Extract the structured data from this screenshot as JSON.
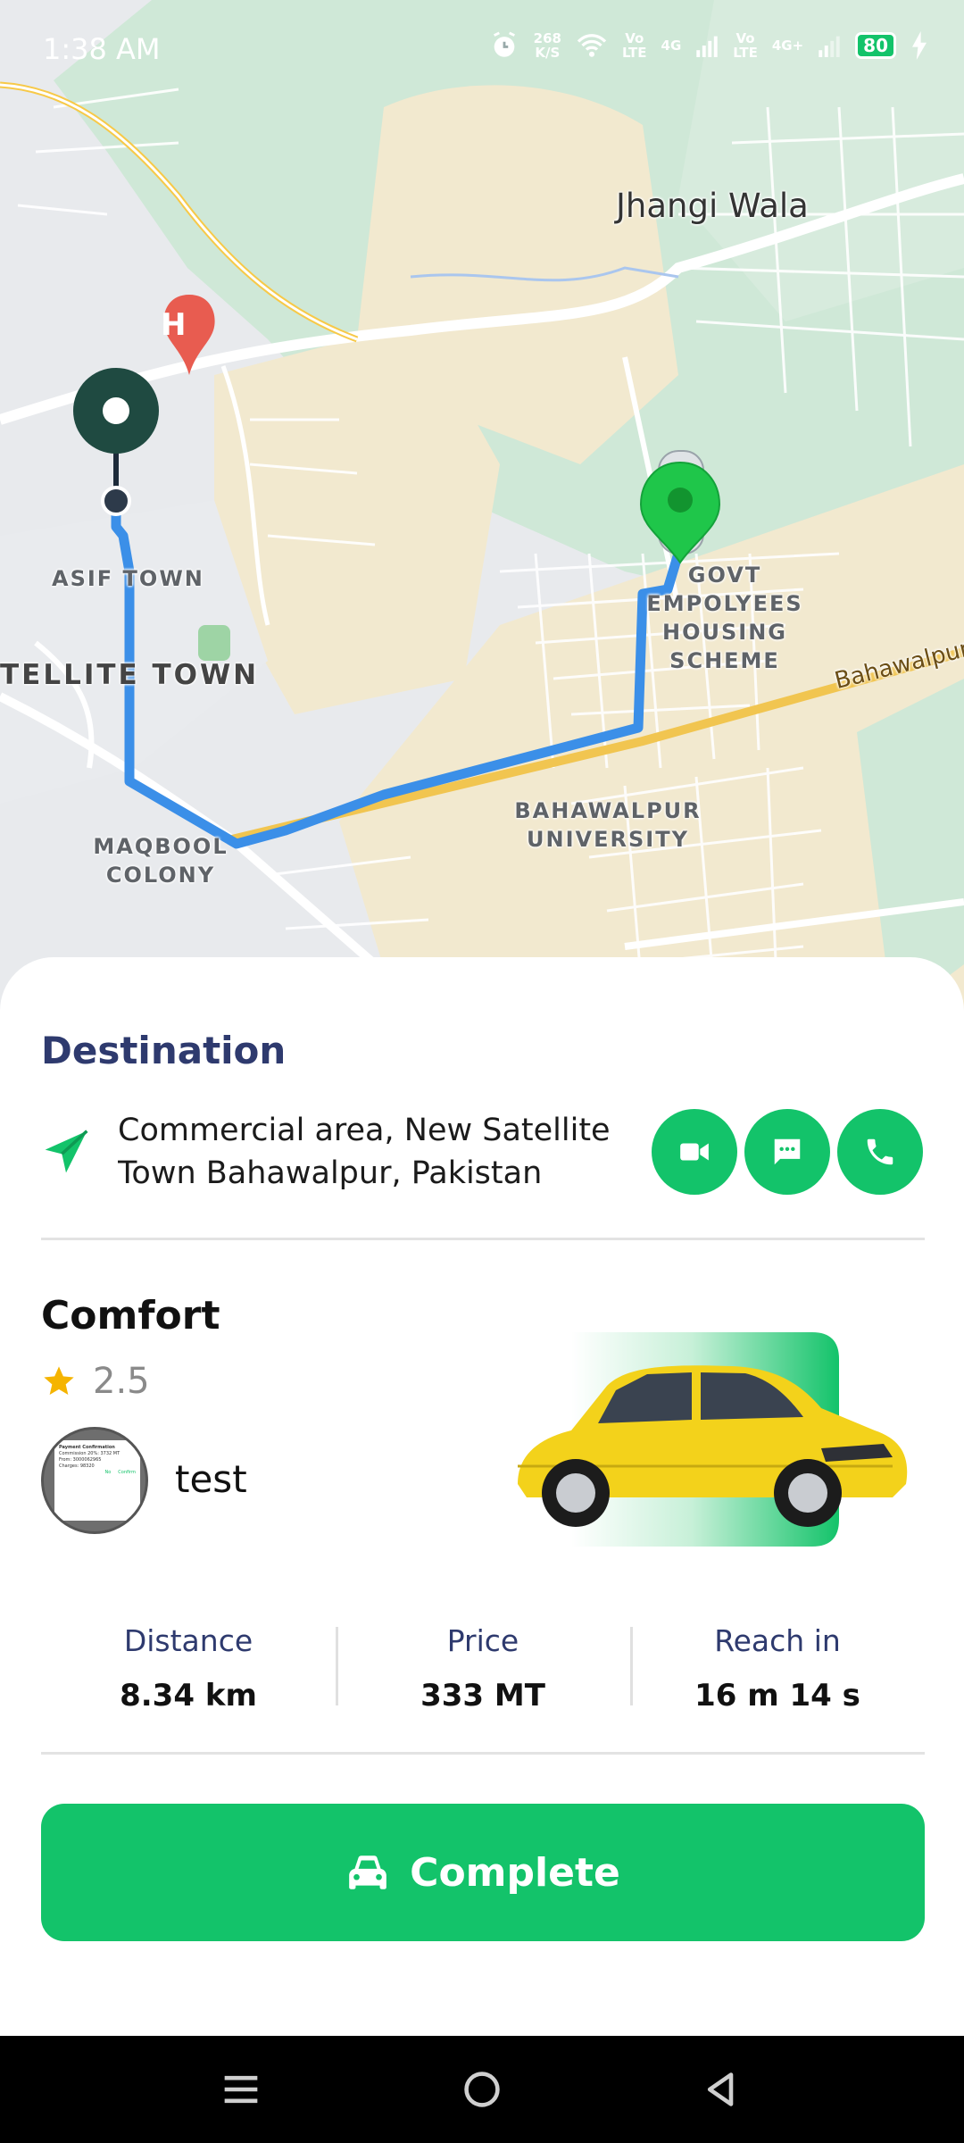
{
  "status_bar": {
    "time": "1:38 AM",
    "net_speed_value": "268",
    "net_speed_unit": "K/S",
    "sim1_top": "Vo",
    "sim1_bottom": "LTE",
    "sim1_gen": "4G",
    "sim2_top": "Vo",
    "sim2_bottom": "LTE",
    "sim2_gen": "4G+",
    "battery": "80"
  },
  "map": {
    "labels": {
      "jhangi_wala": "Jhangi Wala",
      "asif_town": "ASIF TOWN",
      "satellite_town": "TELLITE TOWN",
      "govt_housing": [
        "GOVT",
        "EMPOLYEES",
        "HOUSING",
        "SCHEME"
      ],
      "bahawalpur_road": "Bahawalpur",
      "bahawalpur_university": [
        "BAHAWALPUR",
        "UNIVERSITY"
      ],
      "maqbool_colony": [
        "MAQBOOL",
        "COLONY"
      ]
    },
    "hospital_marker": "H",
    "route_color": "#3b8fe8",
    "destination_pin_color": "#1f4a41",
    "car_pin_color": "#1fc64a"
  },
  "destination": {
    "title": "Destination",
    "address": "Commercial area, New Satellite Town Bahawalpur, Pakistan"
  },
  "actions": {
    "video_icon": "video-camera-icon",
    "chat_icon": "chat-bubble-icon",
    "call_icon": "phone-icon"
  },
  "ride": {
    "vehicle_type": "Comfort",
    "rating": "2.5",
    "driver_name": "test",
    "avatar_text": [
      "Payment Confirmation",
      "Commission 20%: 3732 MT",
      "From: 3000062965",
      "Charges: 98320",
      "No",
      "Confirm"
    ]
  },
  "stats": [
    {
      "label": "Distance",
      "value": "8.34 km"
    },
    {
      "label": "Price",
      "value": "333 MT"
    },
    {
      "label": "Reach in",
      "value": "16 m 14 s"
    }
  ],
  "complete_button": {
    "label": "Complete",
    "icon": "car-icon"
  },
  "colors": {
    "accent": "#13c36a",
    "heading": "#2e3a6e",
    "star": "#f5b400"
  }
}
